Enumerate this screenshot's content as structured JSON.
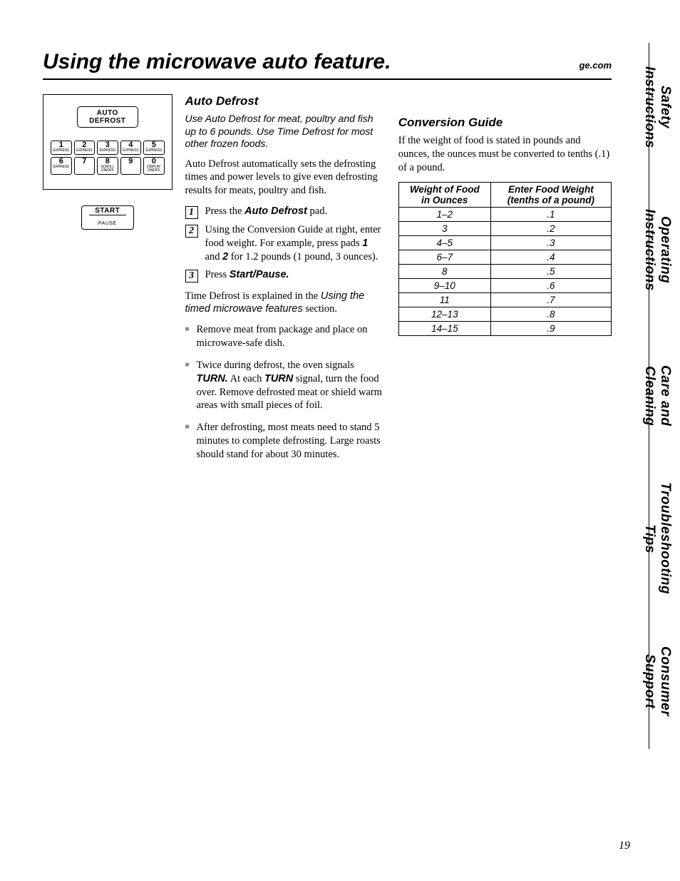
{
  "header": {
    "title": "Using the microwave auto feature.",
    "url": "ge.com"
  },
  "side_tabs": [
    "Safety Instructions",
    "Operating Instructions",
    "Care and Cleaning",
    "Troubleshooting Tips",
    "Consumer Support"
  ],
  "keypad": {
    "auto_line1": "AUTO",
    "auto_line2": "DEFROST",
    "keys": [
      {
        "n": "1",
        "sub": "EXPRESS"
      },
      {
        "n": "2",
        "sub": "EXPRESS"
      },
      {
        "n": "3",
        "sub": "EXPRESS"
      },
      {
        "n": "4",
        "sub": "EXPRESS"
      },
      {
        "n": "5",
        "sub": "EXPRESS"
      },
      {
        "n": "6",
        "sub": "EXPRESS"
      },
      {
        "n": "7",
        "sub": ""
      },
      {
        "n": "8",
        "sub": "SCROLL ON/OFF"
      },
      {
        "n": "9",
        "sub": ""
      },
      {
        "n": "0",
        "sub": "DISPLAY ON/OFF"
      }
    ],
    "start": "START",
    "pause": "PAUSE"
  },
  "mid": {
    "heading": "Auto Defrost",
    "intro": "Use Auto Defrost for meat, poultry and fish up to 6 pounds. Use Time Defrost for most other frozen foods.",
    "para1": "Auto Defrost automatically sets the defrosting times and power levels to give even defrosting results for meats, poultry and fish.",
    "step1_a": "Press the ",
    "step1_b": "Auto Defrost",
    "step1_c": " pad.",
    "step2_a": "Using the Conversion Guide at right, enter food weight. For example, press pads ",
    "step2_b": "1",
    "step2_c": " and ",
    "step2_d": "2",
    "step2_e": " for 1.2 pounds (1 pound, 3 ounces).",
    "step3_a": "Press ",
    "step3_b": "Start/Pause.",
    "td_a": "Time Defrost is explained in the ",
    "td_b": "Using the timed microwave features",
    "td_c": " section.",
    "b1": "Remove meat from package and place on microwave-safe dish.",
    "b2_a": "Twice during defrost, the oven signals ",
    "b2_b": "TURN.",
    "b2_c": " At each ",
    "b2_d": "TURN",
    "b2_e": " signal, turn the food over. Remove defrosted meat or shield warm areas with small pieces of foil.",
    "b3": "After defrosting, most meats need to stand 5 minutes to complete defrosting. Large roasts should stand for about 30 minutes."
  },
  "right": {
    "heading": "Conversion Guide",
    "para": "If the weight of food is stated in pounds and ounces, the ounces must be converted to tenths (.1) of a pound.",
    "th1": "Weight of Food in Ounces",
    "th2": "Enter Food Weight (tenths of a pound)",
    "rows": [
      {
        "oz": "1–2",
        "t": ".1"
      },
      {
        "oz": "3",
        "t": ".2"
      },
      {
        "oz": "4–5",
        "t": ".3"
      },
      {
        "oz": "6–7",
        "t": ".4"
      },
      {
        "oz": "8",
        "t": ".5"
      },
      {
        "oz": "9–10",
        "t": ".6"
      },
      {
        "oz": "11",
        "t": ".7"
      },
      {
        "oz": "12–13",
        "t": ".8"
      },
      {
        "oz": "14–15",
        "t": ".9"
      }
    ]
  },
  "page_number": "19"
}
